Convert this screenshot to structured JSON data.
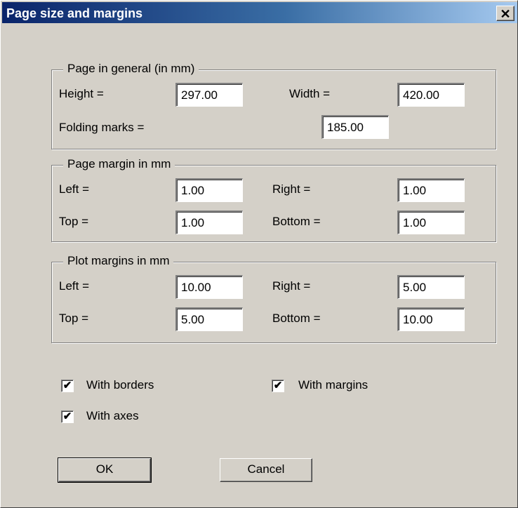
{
  "window": {
    "title": "Page size and margins",
    "close_glyph": "✕"
  },
  "general": {
    "legend": "Page in general (in mm)",
    "height_label": "Height =",
    "height_value": "297.00",
    "width_label": "Width =",
    "width_value": "420.00",
    "folding_label": "Folding marks =",
    "folding_value": "185.00"
  },
  "page_margin": {
    "legend": "Page margin in mm",
    "left_label": "Left =",
    "left_value": "1.00",
    "right_label": "Right =",
    "right_value": "1.00",
    "top_label": "Top =",
    "top_value": "1.00",
    "bottom_label": "Bottom =",
    "bottom_value": "1.00"
  },
  "plot_margin": {
    "legend": "Plot margins in mm",
    "left_label": "Left =",
    "left_value": "10.00",
    "right_label": "Right =",
    "right_value": "5.00",
    "top_label": "Top =",
    "top_value": "5.00",
    "bottom_label": "Bottom =",
    "bottom_value": "10.00"
  },
  "options": {
    "with_borders": {
      "label": "With borders",
      "checked": true
    },
    "with_margins": {
      "label": "With margins",
      "checked": true
    },
    "with_axes": {
      "label": "With axes",
      "checked": true
    },
    "check_glyph": "✔"
  },
  "buttons": {
    "ok": "OK",
    "cancel": "Cancel"
  },
  "colors": {
    "title_start": "#0a246a",
    "title_end": "#a6caf0",
    "face": "#d4d0c8"
  }
}
